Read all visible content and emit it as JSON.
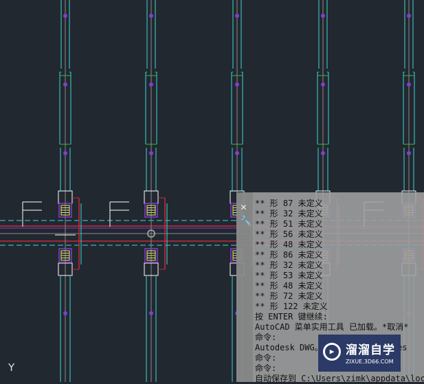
{
  "drawing": {
    "ucs_label": "Y",
    "colors": {
      "background": "#212830",
      "cyan": "#3fd6d6",
      "red": "#c8283a",
      "purple": "#8a3ad0",
      "yellow": "#e8e880",
      "white": "#ffffff",
      "green": "#30c040",
      "gray": "#8a8a8a"
    }
  },
  "command_window": {
    "close_icon": "close-icon",
    "settings_icon": "wrench-icon",
    "lines": [
      "** 形 87 未定义",
      "** 形 32 未定义",
      "** 形 51 未定义",
      "** 形 56 未定义",
      "** 形 48 未定义",
      "** 形 86 未定义",
      "** 形 32 未定义",
      "** 形 53 未定义",
      "** 形 48 未定义",
      "** 形 72 未定义",
      "** 形 122 未定义",
      "按 ENTER 键继续:",
      "AutoCAD 菜单实用工具 已加载。*取消*",
      "命令:",
      "Autodesk DWG。            todes",
      "命令:",
      "命令:",
      "自动保存到 C:\\Users\\zimk\\appdata\\loc"
    ]
  },
  "watermark": {
    "title": "溜溜自学",
    "subtitle": "ZIXUE.3D66.COM"
  }
}
